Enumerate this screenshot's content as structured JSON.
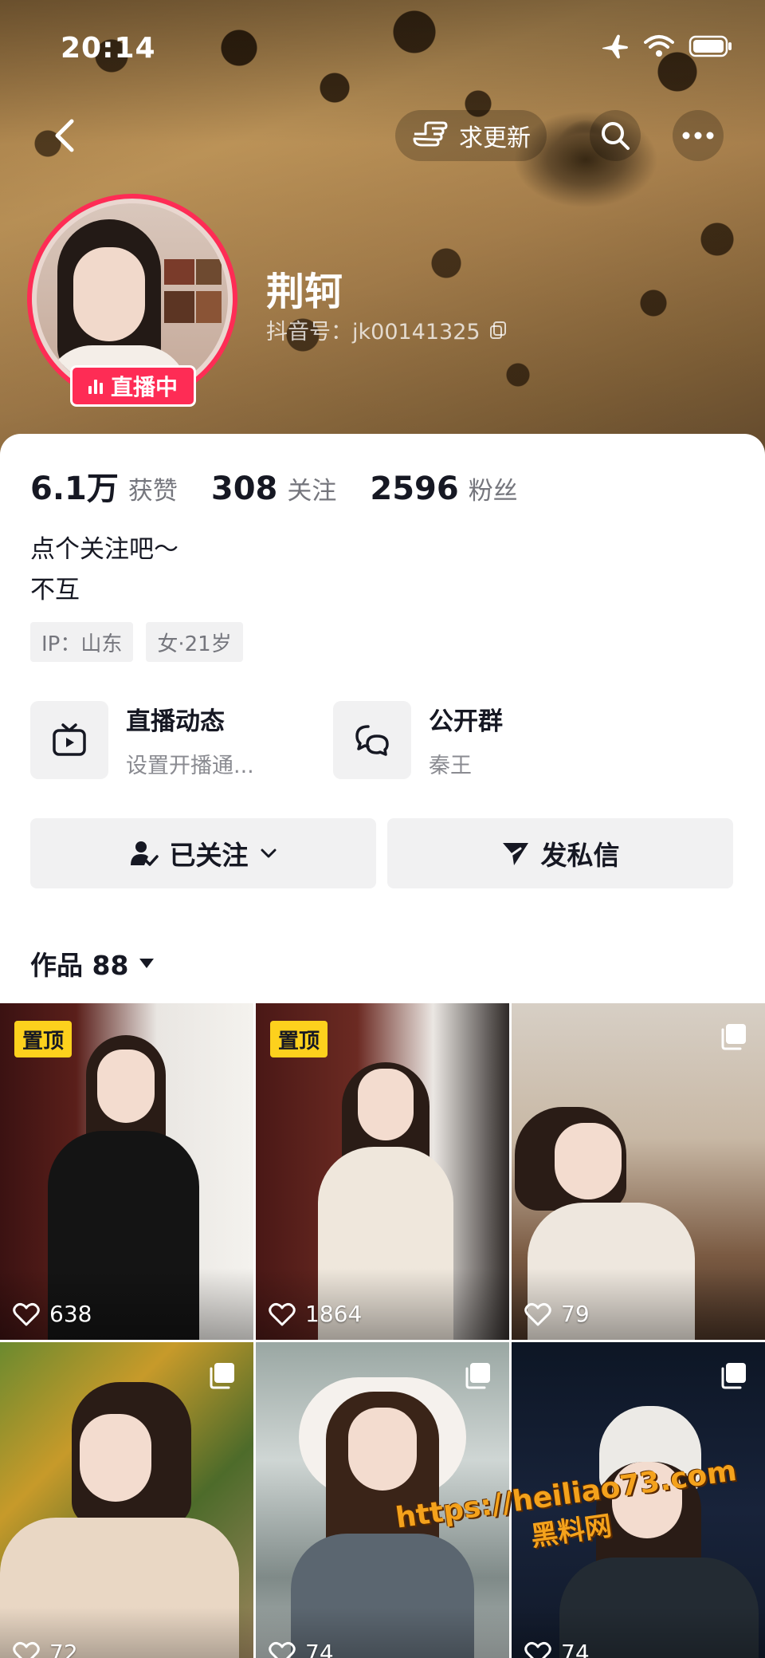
{
  "status_bar": {
    "time": "20:14"
  },
  "top_nav": {
    "request_update_label": "求更新"
  },
  "profile": {
    "nickname": "荆轲",
    "douyin_id": "抖音号：jk00141325",
    "live_badge": "直播中",
    "stats": [
      {
        "value": "6.1万",
        "label": "获赞"
      },
      {
        "value": "308",
        "label": "关注"
      },
      {
        "value": "2596",
        "label": "粉丝"
      }
    ],
    "bio_lines": [
      "点个关注吧～",
      "不互"
    ],
    "tags": [
      "IP：山东",
      "女·21岁"
    ],
    "features": [
      {
        "title": "直播动态",
        "subtitle": "设置开播通...",
        "icon": "tv-icon"
      },
      {
        "title": "公开群",
        "subtitle": "秦王",
        "icon": "group-chat-icon"
      }
    ],
    "buttons": {
      "follow_label": "已关注",
      "message_label": "发私信"
    }
  },
  "works": {
    "label": "作品 88",
    "items": [
      {
        "pinned": "置顶",
        "likes": "638",
        "multi_image": false
      },
      {
        "pinned": "置顶",
        "likes": "1864",
        "multi_image": false
      },
      {
        "pinned": "",
        "likes": "79",
        "multi_image": true
      },
      {
        "pinned": "",
        "likes": "72",
        "multi_image": true
      },
      {
        "pinned": "",
        "likes": "74",
        "multi_image": true
      },
      {
        "pinned": "",
        "likes": "74",
        "multi_image": true
      }
    ]
  },
  "watermark": {
    "url": "https://heiliao73.com",
    "name": "黑料网"
  },
  "colors": {
    "accent": "#fe2c55",
    "pin": "#fdd11d",
    "watermark": "#f4a21c"
  }
}
